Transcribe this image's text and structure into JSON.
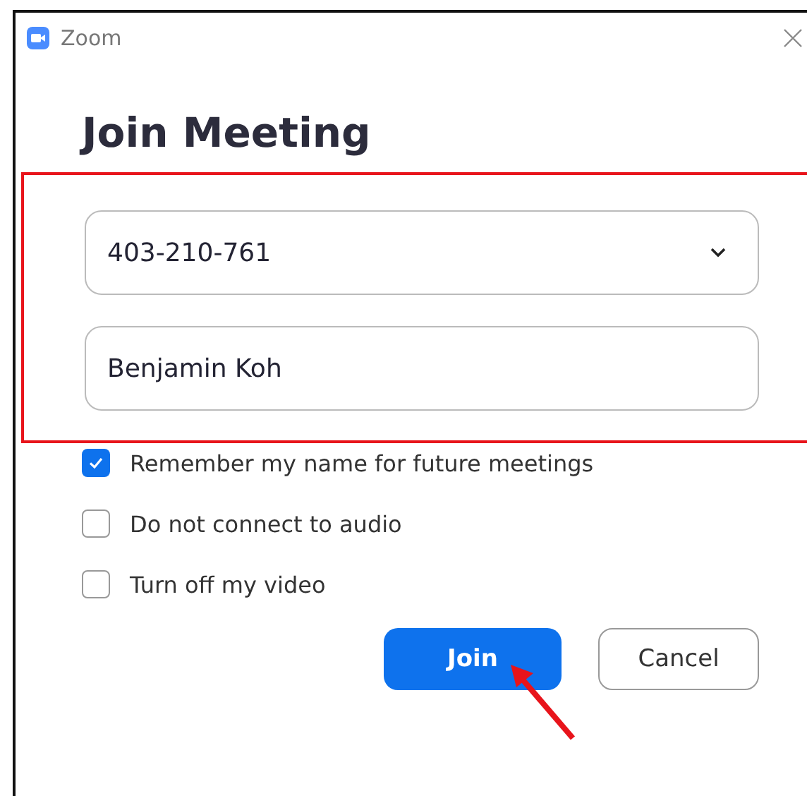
{
  "window": {
    "title": "Zoom"
  },
  "heading": "Join Meeting",
  "meeting_id": {
    "value": "403-210-761"
  },
  "name_field": {
    "value": "Benjamin Koh"
  },
  "options": [
    {
      "label": "Remember my name for future meetings",
      "checked": true
    },
    {
      "label": "Do not connect to audio",
      "checked": false
    },
    {
      "label": "Turn off my video",
      "checked": false
    }
  ],
  "buttons": [
    {
      "label": "Join",
      "kind": "primary"
    },
    {
      "label": "Cancel",
      "kind": "secondary"
    }
  ]
}
